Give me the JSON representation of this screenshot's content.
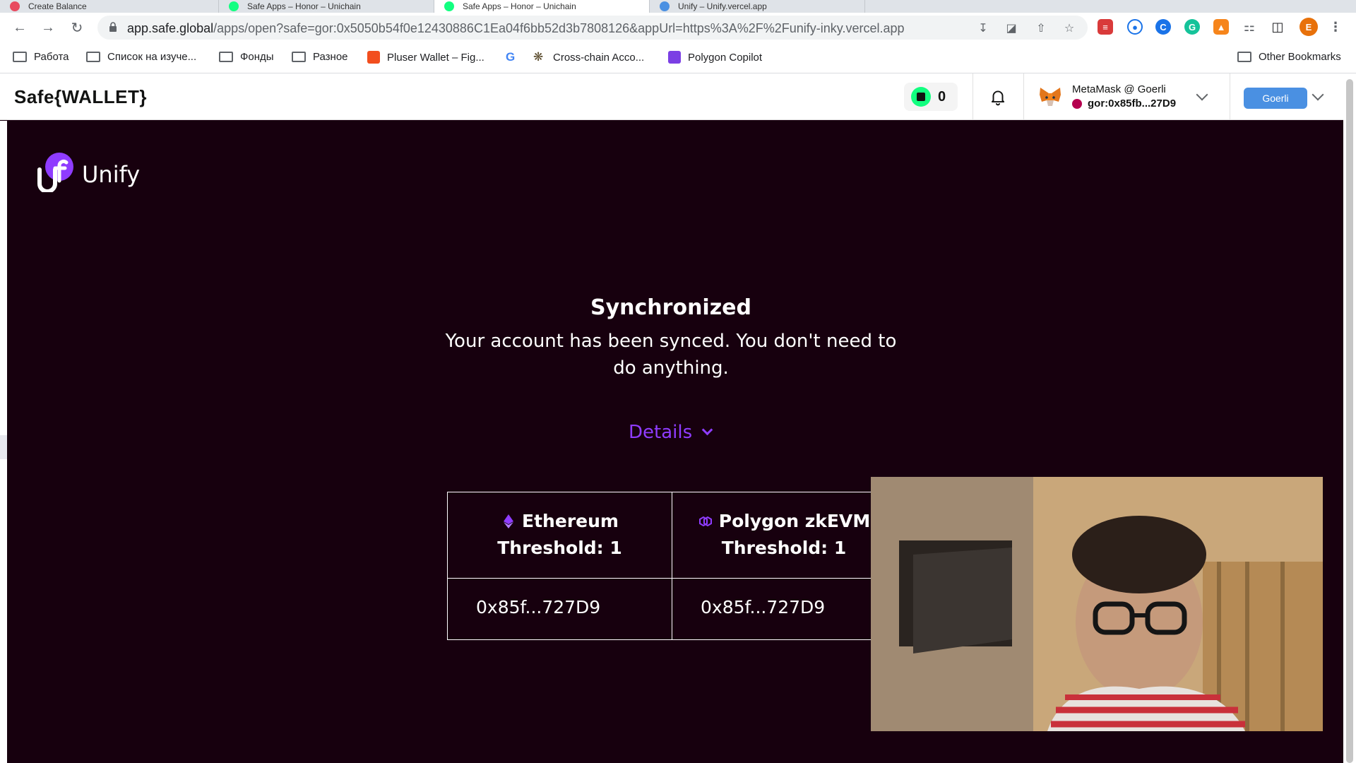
{
  "browser": {
    "tabs": [
      {
        "label": "Create Balance"
      },
      {
        "label": "Safe Apps – Honor – Unichain"
      },
      {
        "label": "Safe Apps – Honor – Unichain"
      },
      {
        "label": "Unify – Unify.vercel.app"
      }
    ],
    "url_host": "app.safe.global",
    "url_path": "/apps/open?safe=gor:0x5050b54f0e12430886C1Ea04f6bb52d3b7808126&appUrl=https%3A%2F%2Funify-inky.vercel.app",
    "profile_initial": "E",
    "bookmarks": [
      {
        "label": "Работа"
      },
      {
        "label": "Список на изуче..."
      },
      {
        "label": "Фонды"
      },
      {
        "label": "Разное"
      },
      {
        "label": "Pluser Wallet – Fig..."
      },
      {
        "label": ""
      },
      {
        "label": "Cross-chain Acco..."
      },
      {
        "label": "Polygon Copilot"
      }
    ],
    "other_bookmarks": "Other Bookmarks"
  },
  "safe": {
    "logo": "Safe{WALLET}",
    "token_count": "0",
    "wallet_name": "MetaMask @ Goerli",
    "wallet_address": "gor:0x85fb...27D9",
    "network": "Goerli"
  },
  "unify": {
    "brand": "Unify",
    "title": "Synchronized",
    "description": "Your account has been synced. You don't need to do anything.",
    "details_label": "Details",
    "networks": [
      {
        "name": "Ethereum",
        "threshold": "Threshold: 1",
        "owner": "0x85f...727D9",
        "icon": "ethereum-icon"
      },
      {
        "name": "Polygon zkEVM",
        "threshold": "Threshold: 1",
        "owner": "0x85f...727D9",
        "icon": "polygon-icon"
      }
    ]
  },
  "colors": {
    "app_bg": "#17000e",
    "accent_purple": "#8f3cff",
    "network_button": "#4a90e2",
    "safe_green": "#12ff80"
  }
}
